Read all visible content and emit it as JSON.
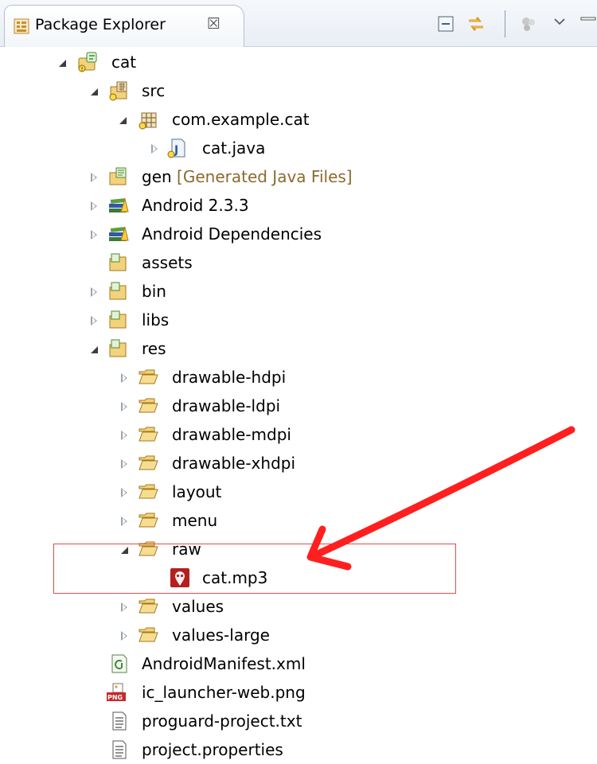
{
  "view": {
    "title": "Package Explorer",
    "close_glyph": "☒"
  },
  "tree": [
    {
      "label": "cat",
      "icon": "android-project-icon",
      "expanded": true
    },
    {
      "label": "src",
      "icon": "source-folder-icon",
      "expanded": true
    },
    {
      "label": "com.example.cat",
      "icon": "package-icon",
      "expanded": true
    },
    {
      "label": "cat.java",
      "icon": "java-file-icon",
      "expanded": false
    },
    {
      "label": "gen",
      "decoration": "[Generated Java Files]",
      "icon": "source-folder-icon",
      "expanded": false
    },
    {
      "label": "Android 2.3.3",
      "icon": "library-icon",
      "expanded": false
    },
    {
      "label": "Android Dependencies",
      "icon": "library-icon",
      "expanded": false
    },
    {
      "label": "assets",
      "icon": "folder-icon"
    },
    {
      "label": "bin",
      "icon": "folder-icon",
      "expanded": false
    },
    {
      "label": "libs",
      "icon": "folder-icon",
      "expanded": false
    },
    {
      "label": "res",
      "icon": "folder-icon",
      "expanded": true
    },
    {
      "label": "drawable-hdpi",
      "icon": "folder-open-icon",
      "expanded": false
    },
    {
      "label": "drawable-ldpi",
      "icon": "folder-open-icon",
      "expanded": false
    },
    {
      "label": "drawable-mdpi",
      "icon": "folder-open-icon",
      "expanded": false
    },
    {
      "label": "drawable-xhdpi",
      "icon": "folder-open-icon",
      "expanded": false
    },
    {
      "label": "layout",
      "icon": "folder-open-icon",
      "expanded": false
    },
    {
      "label": "menu",
      "icon": "folder-open-icon",
      "expanded": false
    },
    {
      "label": "raw",
      "icon": "folder-open-icon",
      "expanded": true
    },
    {
      "label": "cat.mp3",
      "icon": "audio-file-icon"
    },
    {
      "label": "values",
      "icon": "folder-open-icon",
      "expanded": false
    },
    {
      "label": "values-large",
      "icon": "folder-open-icon",
      "expanded": false
    },
    {
      "label": "AndroidManifest.xml",
      "icon": "xml-file-icon"
    },
    {
      "label": "ic_launcher-web.png",
      "icon": "png-file-icon"
    },
    {
      "label": "proguard-project.txt",
      "icon": "text-file-icon"
    },
    {
      "label": "project.properties",
      "icon": "text-file-icon"
    }
  ],
  "png_badge": "PNG",
  "highlight_color": "#e24b4b"
}
